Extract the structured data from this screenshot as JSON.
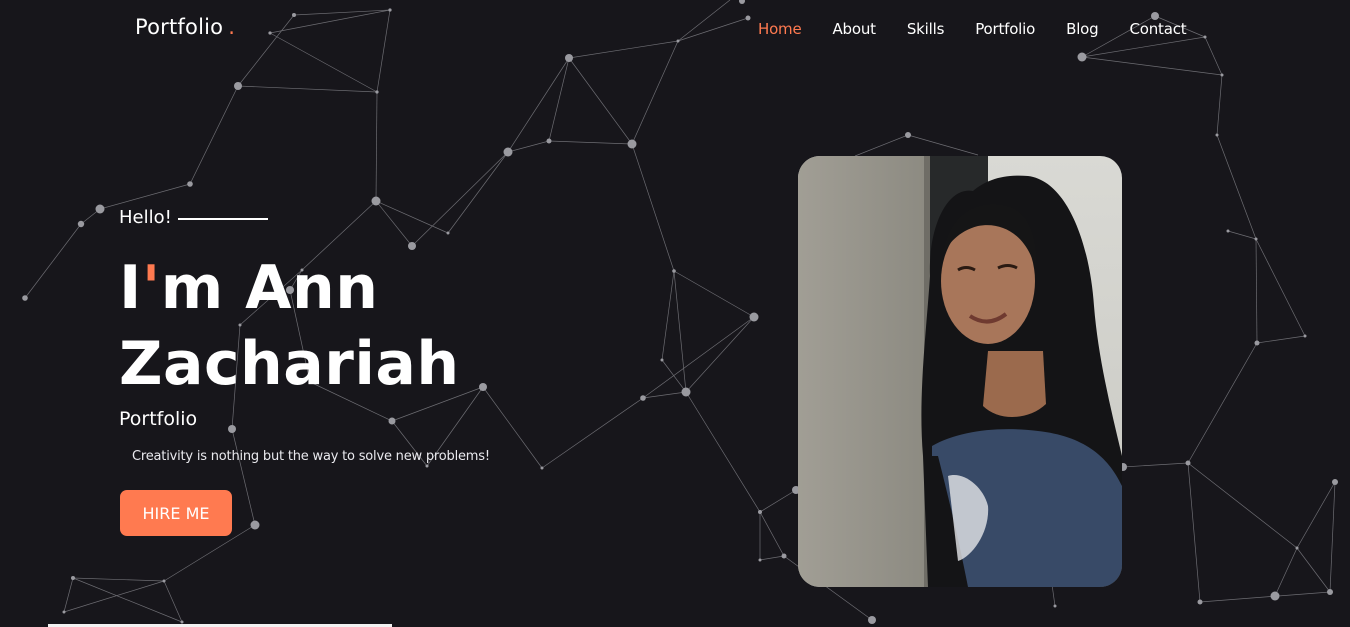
{
  "brand": {
    "name": "Portfolio",
    "dot": "."
  },
  "nav": [
    {
      "label": "Home",
      "active": true
    },
    {
      "label": "About"
    },
    {
      "label": "Skills"
    },
    {
      "label": "Portfolio"
    },
    {
      "label": "Blog"
    },
    {
      "label": "Contact"
    }
  ],
  "hero": {
    "greeting": "Hello!",
    "name_first_letter": "I",
    "name_apostrophe": "'",
    "name_line1_rest": "m Ann",
    "name_line2": "Zachariah",
    "role": "Portfolio",
    "tagline": "Creativity is nothing but the way to solve new problems!",
    "cta_label": "HIRE ME"
  },
  "colors": {
    "accent": "#ff7a50",
    "background": "#17161b",
    "text": "#ffffff"
  }
}
